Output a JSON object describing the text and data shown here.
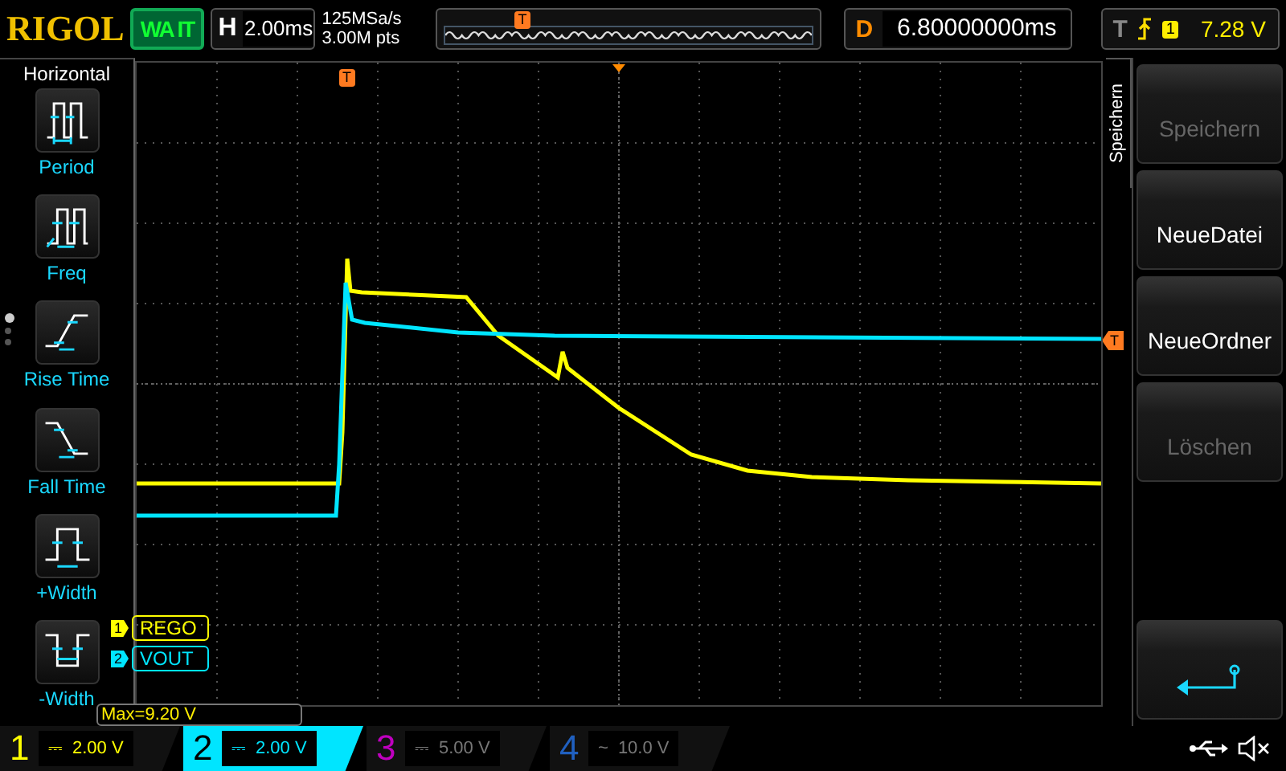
{
  "brand": "RIGOL",
  "run_state": "WA IT",
  "timebase": {
    "label": "H",
    "value": "2.00ms"
  },
  "acquisition": {
    "sample_rate": "125MSa/s",
    "memory_depth": "3.00M pts",
    "position_marker": "T"
  },
  "delay": {
    "label": "D",
    "value": "6.80000000ms"
  },
  "trigger": {
    "label": "T",
    "source": "1",
    "level": "7.28 V"
  },
  "measure_menu": {
    "title": "Horizontal",
    "items": [
      {
        "label": "Period",
        "kind": "period"
      },
      {
        "label": "Freq",
        "kind": "freq"
      },
      {
        "label": "Rise Time",
        "kind": "rise"
      },
      {
        "label": "Fall Time",
        "kind": "fall"
      },
      {
        "label": "+Width",
        "kind": "pwidth"
      },
      {
        "label": "-Width",
        "kind": "nwidth"
      }
    ],
    "pages": [
      {
        "selected": true
      },
      {
        "selected": false
      },
      {
        "selected": false
      }
    ]
  },
  "screen": {
    "trigger_position_marker": "T",
    "trigger_level_marker": "T",
    "measurement": "Max=9.20 V",
    "traces": [
      {
        "marker": "1",
        "label": "REGO",
        "color": "#ffff00"
      },
      {
        "marker": "2",
        "label": "VOUT",
        "color": "#00e5ff"
      }
    ]
  },
  "softkeys": {
    "title": "Speichern",
    "items": [
      {
        "kind": "text",
        "label": "Speichern",
        "disabled": true
      },
      {
        "kind": "text",
        "label": "NeueDatei",
        "disabled": false
      },
      {
        "kind": "text",
        "label": "NeueOrdner",
        "disabled": false
      },
      {
        "kind": "text",
        "label": "Löschen",
        "disabled": true
      },
      {
        "kind": "back"
      }
    ]
  },
  "channels": [
    {
      "number": "1",
      "coupling": "⎓",
      "scale": "2.00 V",
      "enabled": true,
      "selected": false,
      "color": "#ffff00"
    },
    {
      "number": "2",
      "coupling": "⎓",
      "scale": "2.00 V",
      "enabled": true,
      "selected": true,
      "color": "#00e5ff"
    },
    {
      "number": "3",
      "coupling": "⎓",
      "scale": "5.00 V",
      "enabled": false,
      "selected": false,
      "color": "#c000c0"
    },
    {
      "number": "4",
      "coupling": "~",
      "scale": "10.0 V",
      "enabled": false,
      "selected": false,
      "color": "#2060c0"
    }
  ]
}
